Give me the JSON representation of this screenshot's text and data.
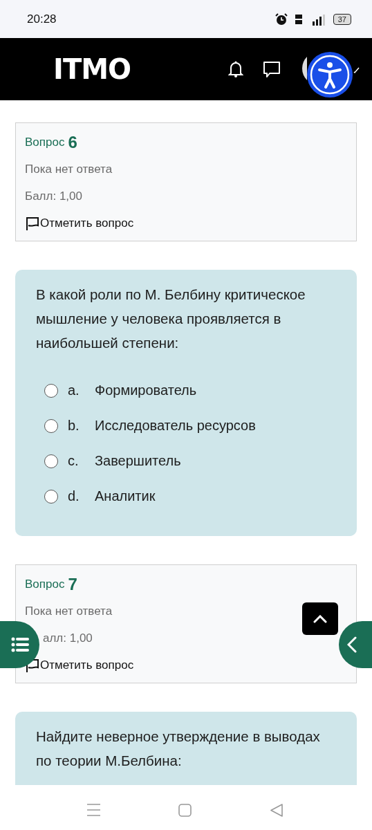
{
  "status_bar": {
    "time": "20:28",
    "battery": "37"
  },
  "header": {
    "logo": "ITMO"
  },
  "blocks": [
    {
      "kind": "info",
      "label": "Вопрос",
      "number": "6",
      "status": "Пока нет ответа",
      "grade": "Балл: 1,00",
      "flag": "Отметить вопрос"
    },
    {
      "kind": "question",
      "text": "В какой роли по М. Белбину критическое мышление у человека проявляется в наибольшей степени:",
      "options": [
        {
          "letter": "a.",
          "text": "Формирователь",
          "selected": false
        },
        {
          "letter": "b.",
          "text": "Исследователь ресурсов",
          "selected": false
        },
        {
          "letter": "c.",
          "text": "Завершитель",
          "selected": false
        },
        {
          "letter": "d.",
          "text": "Аналитик",
          "selected": false
        }
      ]
    },
    {
      "kind": "info",
      "label": "Вопрос",
      "number": "7",
      "status": "Пока нет ответа",
      "grade": "алл: 1,00",
      "flag": "Отметить вопрос"
    },
    {
      "kind": "question",
      "text": "Найдите неверное утверждение в выводах по теории М.Белбина:"
    }
  ]
}
